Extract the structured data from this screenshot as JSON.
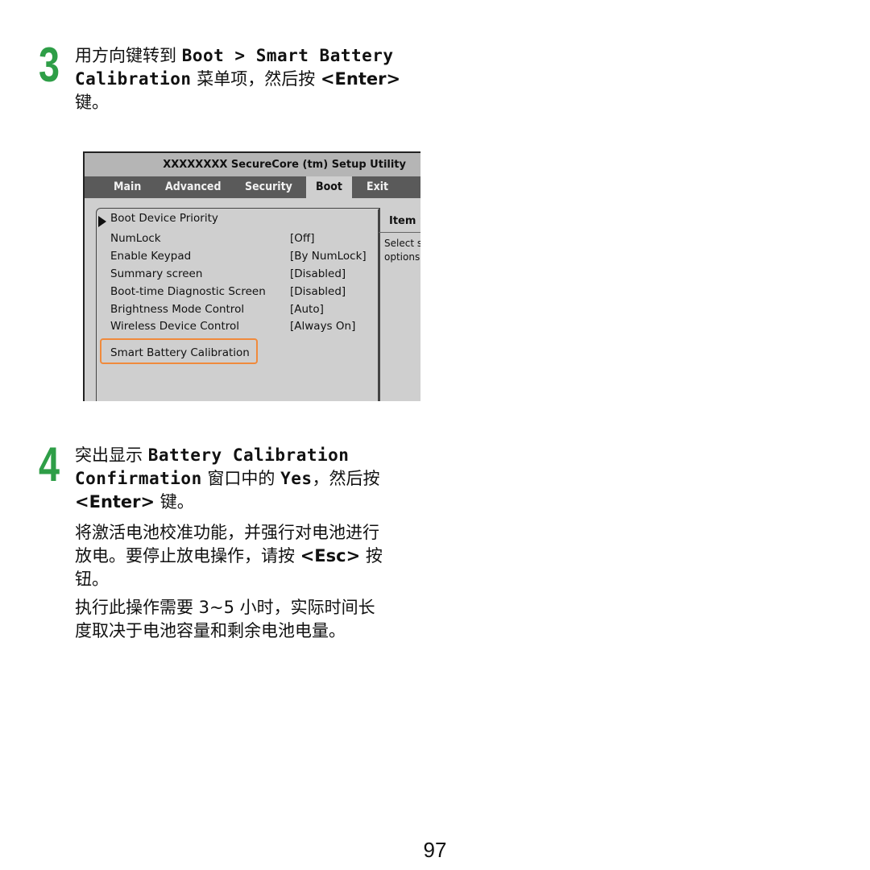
{
  "step3": {
    "number": "3",
    "line1_cn": "用方向键转到 ",
    "line1_path": "Boot > Smart Battery",
    "line2_path": "Calibration",
    "line2_cn": " 菜单项，然后按 ",
    "line2_key": "<Enter>",
    "line3_cn": "键。"
  },
  "bios": {
    "title": "XXXXXXXX SecureCore (tm) Setup Utility",
    "tabs": [
      "Main",
      "Advanced",
      "Security",
      "Boot",
      "Exit"
    ],
    "active_tab": "Boot",
    "submenu": "Boot Device Priority",
    "items": [
      {
        "label": "NumLock",
        "value": "[Off]"
      },
      {
        "label": "Enable Keypad",
        "value": "[By NumLock]"
      },
      {
        "label": "Summary screen",
        "value": "[Disabled]"
      },
      {
        "label": "Boot-time Diagnostic Screen",
        "value": "[Disabled]"
      },
      {
        "label": "Brightness Mode Control",
        "value": "[Auto]"
      },
      {
        "label": "Wireless Device Control",
        "value": "[Always On]"
      }
    ],
    "highlighted_item": "Smart Battery Calibration",
    "help_title": "Item S",
    "help_lines": [
      "Select s",
      "options"
    ],
    "highlight_color": "#f08a3c"
  },
  "step4": {
    "number": "4",
    "line1_cn": "突出显示 ",
    "line1_en": "Battery Calibration",
    "line2_en": "Confirmation",
    "line2_cn": " 窗口中的 ",
    "line2_yes": "Yes",
    "line2_cn2": "，然后按",
    "line3_key": "<Enter>",
    "line3_cn": " 键。"
  },
  "para1": {
    "line1": "将激活电池校准功能，并强行对电池进行",
    "line2_a": "放电。要停止放电操作，请按 ",
    "line2_key": "<Esc>",
    "line2_b": " 按",
    "line3": "钮。"
  },
  "para2": {
    "line1": "执行此操作需要 3~5 小时，实际时间长",
    "line2": "度取决于电池容量和剩余电池电量。"
  },
  "page_number": "97",
  "accent_color": "#2e9e47"
}
